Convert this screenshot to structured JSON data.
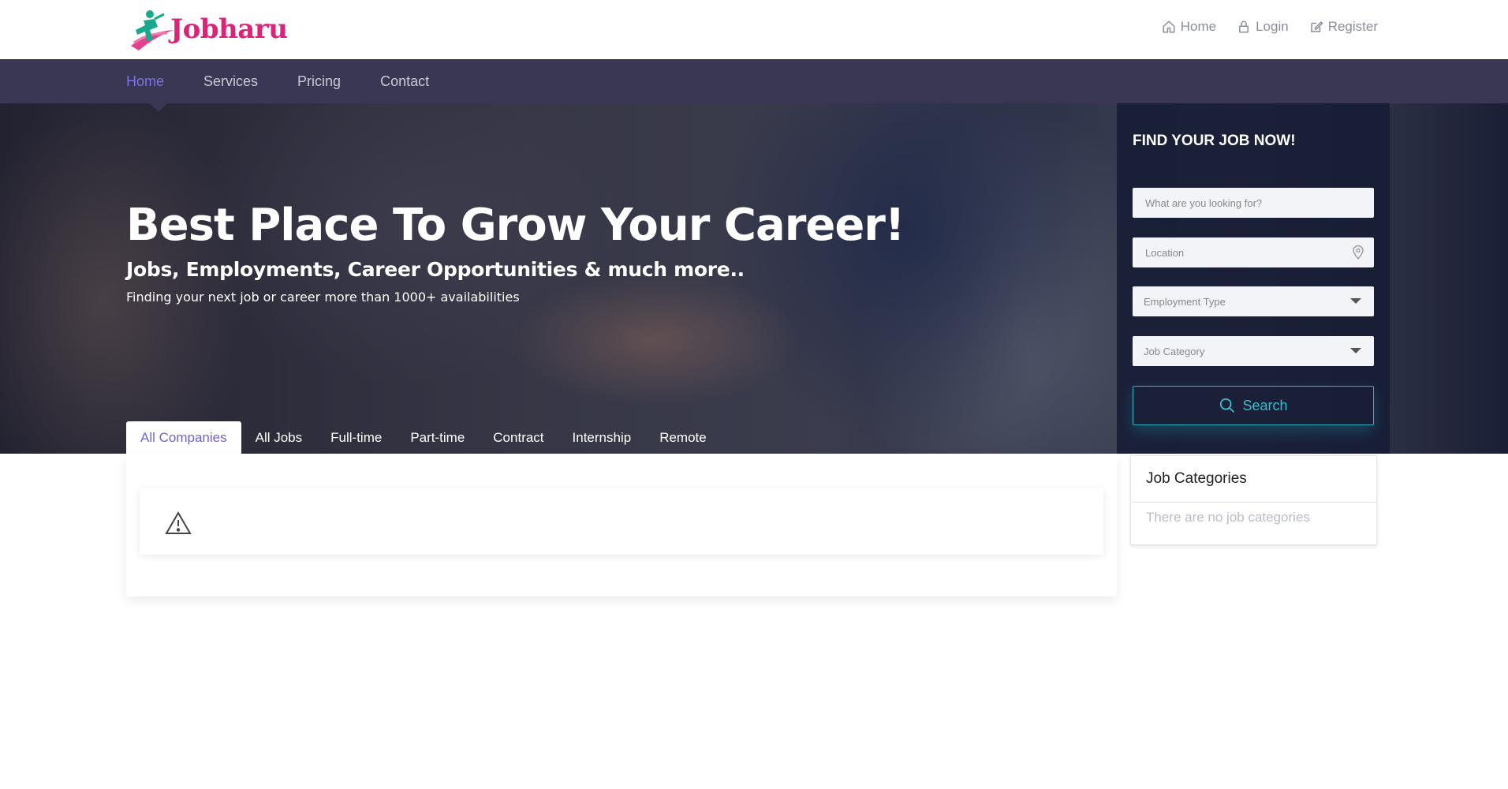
{
  "brand": {
    "name": "Jobharu",
    "color": "#e0217a"
  },
  "top_links": [
    {
      "label": "Home",
      "icon": "home-icon"
    },
    {
      "label": "Login",
      "icon": "lock-icon"
    },
    {
      "label": "Register",
      "icon": "edit-icon"
    }
  ],
  "nav": {
    "items": [
      "Home",
      "Services",
      "Pricing",
      "Contact"
    ],
    "active": "Home",
    "background": "#3a3755",
    "active_color": "#7c72e4"
  },
  "hero": {
    "title": "Best Place To Grow Your Career!",
    "subtitle": "Jobs, Employments, Career Opportunities & much more..",
    "description": "Finding your next job or career more than 1000+ availabilities"
  },
  "tabs": {
    "items": [
      "All Companies",
      "All Jobs",
      "Full-time",
      "Part-time",
      "Contract",
      "Internship",
      "Remote"
    ],
    "active": "All Companies"
  },
  "search": {
    "title": "FIND YOUR JOB NOW!",
    "keyword_placeholder": "What are you looking for?",
    "location_placeholder": "Location",
    "employment_type": "Employment Type",
    "job_category": "Job Category",
    "button_label": "Search",
    "accent": "#35c0d2"
  },
  "content": {
    "alert_icon": "warning-icon"
  },
  "categories": {
    "title": "Job Categories",
    "empty_text": "There are no job categories"
  }
}
